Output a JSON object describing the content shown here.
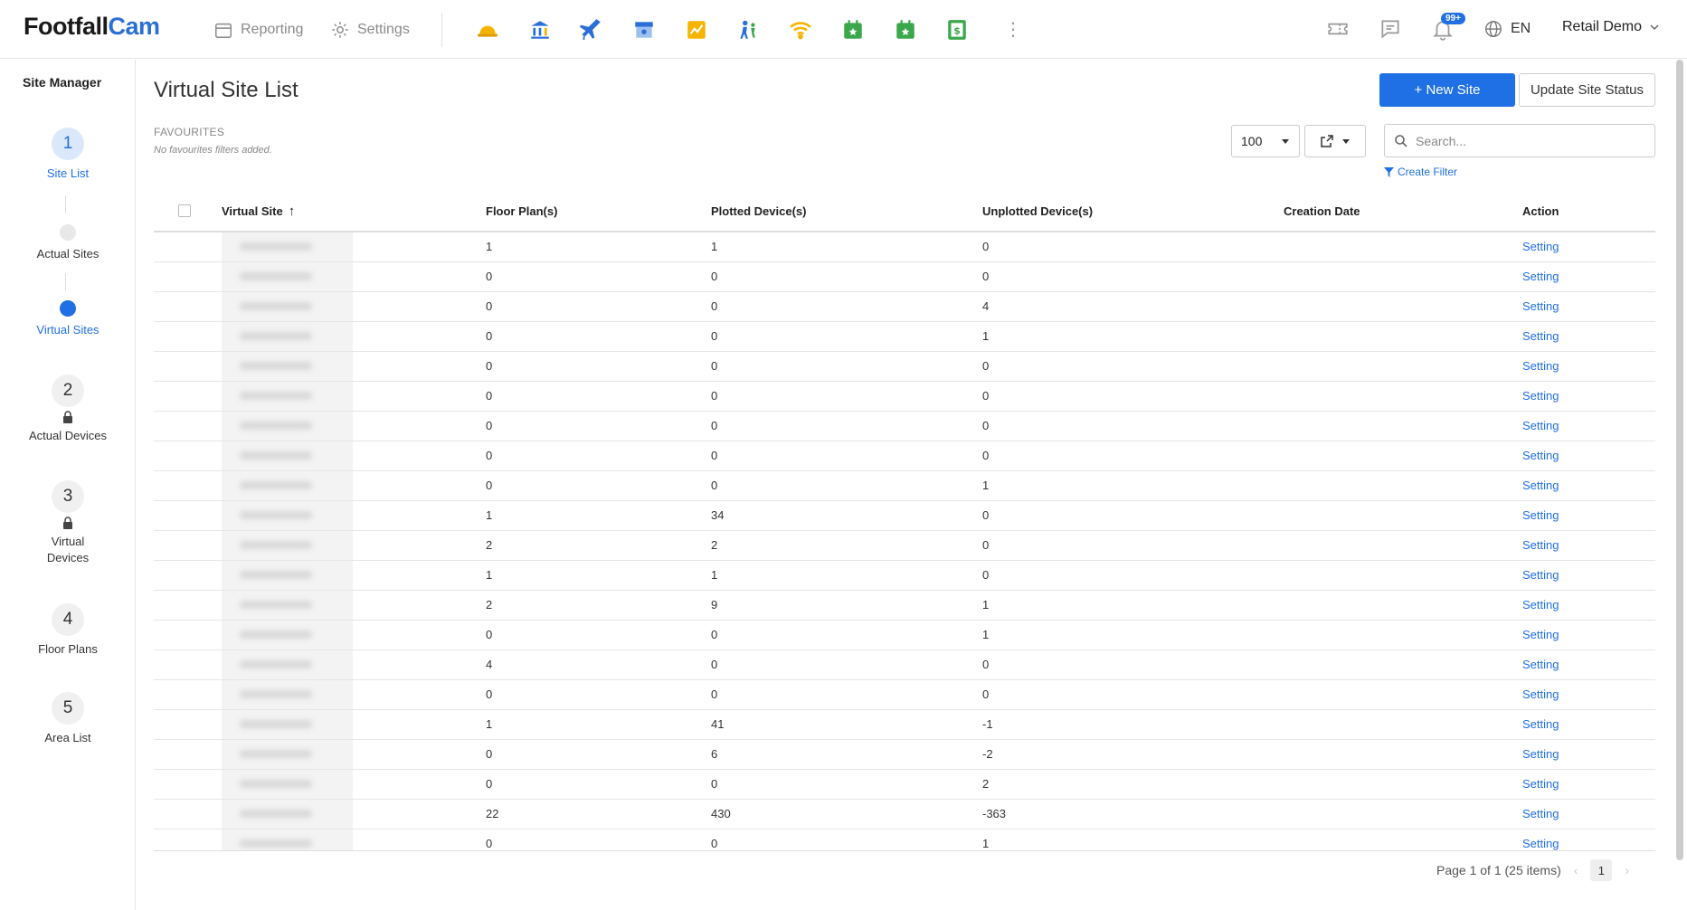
{
  "header": {
    "logo_main": "Footfall",
    "logo_accent": "Cam",
    "nav": [
      {
        "label": "Reporting",
        "icon": "calendar-icon"
      },
      {
        "label": "Settings",
        "icon": "gear-icon"
      }
    ],
    "apps": [
      {
        "icon": "hardhat-icon",
        "color": "#f5b400"
      },
      {
        "icon": "bank-icon",
        "color": "#2a6fd6"
      },
      {
        "icon": "airplane-icon",
        "color": "#2a6fd6"
      },
      {
        "icon": "store-icon",
        "color": "#2a6fd6"
      },
      {
        "icon": "chart-icon",
        "color": "#f5b400"
      },
      {
        "icon": "people-icon",
        "color": "#2a6fd6"
      },
      {
        "icon": "wifi-icon",
        "color": "#f5b400"
      },
      {
        "icon": "calendar-star-icon",
        "color": "#3aa84a"
      },
      {
        "icon": "calendar-star-icon",
        "color": "#3aa84a"
      },
      {
        "icon": "dollar-sheet-icon",
        "color": "#3aa84a"
      }
    ],
    "notification_badge": "99+",
    "language": "EN",
    "user": "Retail Demo"
  },
  "sidebar": {
    "title": "Site Manager",
    "steps": [
      {
        "number": "1",
        "label": "Site List",
        "active": true
      },
      {
        "sub": true,
        "label": "Actual Sites",
        "active": false
      },
      {
        "sub": true,
        "label": "Virtual Sites",
        "active": true
      },
      {
        "number": "2",
        "label": "Actual Devices",
        "locked": true
      },
      {
        "number": "3",
        "label": "Virtual Devices",
        "locked": true
      },
      {
        "number": "4",
        "label": "Floor Plans"
      },
      {
        "number": "5",
        "label": "Area List"
      }
    ]
  },
  "main": {
    "title": "Virtual Site List",
    "new_site_label": "+ New Site",
    "update_status_label": "Update Site Status",
    "favourites_title": "FAVOURITES",
    "favourites_empty": "No favourites filters added.",
    "page_size": "100",
    "search_placeholder": "Search...",
    "create_filter_label": "Create Filter",
    "table": {
      "columns": [
        "Virtual Site",
        "Floor Plan(s)",
        "Plotted Device(s)",
        "Unplotted Device(s)",
        "Creation Date",
        "Action"
      ],
      "rows": [
        {
          "floor": "1",
          "plotted": "1",
          "unplotted": "0",
          "action": "Setting"
        },
        {
          "floor": "0",
          "plotted": "0",
          "unplotted": "0",
          "action": "Setting"
        },
        {
          "floor": "0",
          "plotted": "0",
          "unplotted": "4",
          "action": "Setting"
        },
        {
          "floor": "0",
          "plotted": "0",
          "unplotted": "1",
          "action": "Setting"
        },
        {
          "floor": "0",
          "plotted": "0",
          "unplotted": "0",
          "action": "Setting"
        },
        {
          "floor": "0",
          "plotted": "0",
          "unplotted": "0",
          "action": "Setting"
        },
        {
          "floor": "0",
          "plotted": "0",
          "unplotted": "0",
          "action": "Setting"
        },
        {
          "floor": "0",
          "plotted": "0",
          "unplotted": "0",
          "action": "Setting"
        },
        {
          "floor": "0",
          "plotted": "0",
          "unplotted": "1",
          "action": "Setting"
        },
        {
          "floor": "1",
          "plotted": "34",
          "unplotted": "0",
          "action": "Setting"
        },
        {
          "floor": "2",
          "plotted": "2",
          "unplotted": "0",
          "action": "Setting"
        },
        {
          "floor": "1",
          "plotted": "1",
          "unplotted": "0",
          "action": "Setting"
        },
        {
          "floor": "2",
          "plotted": "9",
          "unplotted": "1",
          "action": "Setting"
        },
        {
          "floor": "0",
          "plotted": "0",
          "unplotted": "1",
          "action": "Setting"
        },
        {
          "floor": "4",
          "plotted": "0",
          "unplotted": "0",
          "action": "Setting"
        },
        {
          "floor": "0",
          "plotted": "0",
          "unplotted": "0",
          "action": "Setting"
        },
        {
          "floor": "1",
          "plotted": "41",
          "unplotted": "-1",
          "action": "Setting"
        },
        {
          "floor": "0",
          "plotted": "6",
          "unplotted": "-2",
          "action": "Setting"
        },
        {
          "floor": "0",
          "plotted": "0",
          "unplotted": "2",
          "action": "Setting"
        },
        {
          "floor": "22",
          "plotted": "430",
          "unplotted": "-363",
          "action": "Setting"
        },
        {
          "floor": "0",
          "plotted": "0",
          "unplotted": "1",
          "action": "Setting"
        }
      ]
    },
    "pagination": {
      "summary": "Page 1 of 1 (25 items)",
      "current": "1"
    }
  },
  "colors": {
    "accent": "#1f6fe5",
    "brand": "#2a6fd6"
  }
}
